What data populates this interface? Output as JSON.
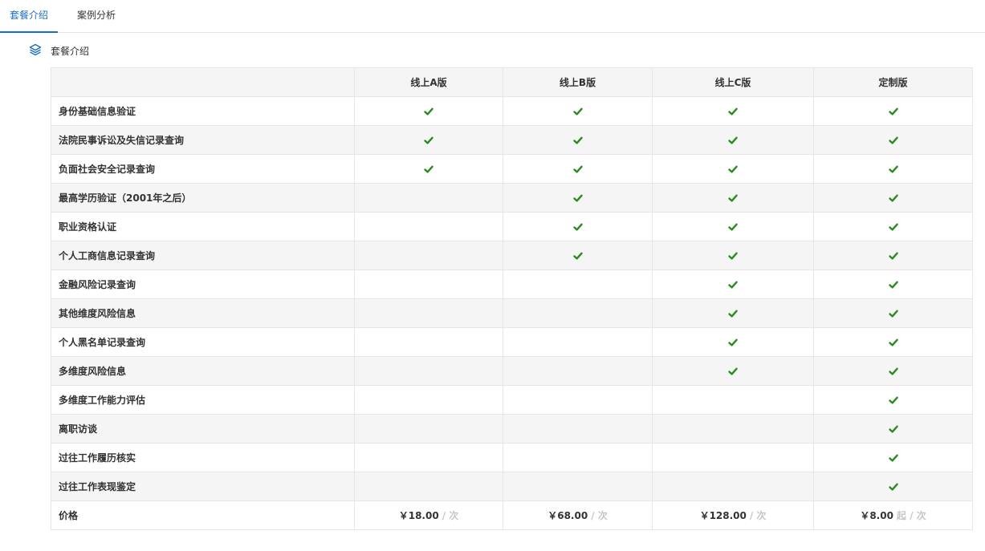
{
  "tabs": [
    {
      "label": "套餐介绍",
      "active": true
    },
    {
      "label": "案例分析",
      "active": false
    }
  ],
  "section": {
    "title": "套餐介绍",
    "icon": "layers-icon"
  },
  "colors": {
    "accent": "#1f6ec2",
    "check": "#2b8a1f",
    "muted": "#c6c6c6"
  },
  "table": {
    "columns": [
      "",
      "线上A版",
      "线上B版",
      "线上C版",
      "定制版"
    ],
    "rows": [
      {
        "name": "身份基础信息验证",
        "checks": [
          true,
          true,
          true,
          true
        ]
      },
      {
        "name": "法院民事诉讼及失信记录查询",
        "checks": [
          true,
          true,
          true,
          true
        ]
      },
      {
        "name": "负面社会安全记录查询",
        "checks": [
          true,
          true,
          true,
          true
        ]
      },
      {
        "name": "最高学历验证（2001年之后）",
        "checks": [
          false,
          true,
          true,
          true
        ]
      },
      {
        "name": "职业资格认证",
        "checks": [
          false,
          true,
          true,
          true
        ]
      },
      {
        "name": "个人工商信息记录查询",
        "checks": [
          false,
          true,
          true,
          true
        ]
      },
      {
        "name": "金融风险记录查询",
        "checks": [
          false,
          false,
          true,
          true
        ]
      },
      {
        "name": "其他维度风险信息",
        "checks": [
          false,
          false,
          true,
          true
        ]
      },
      {
        "name": "个人黑名单记录查询",
        "checks": [
          false,
          false,
          true,
          true
        ]
      },
      {
        "name": "多维度风险信息",
        "checks": [
          false,
          false,
          true,
          true
        ]
      },
      {
        "name": "多维度工作能力评估",
        "checks": [
          false,
          false,
          false,
          true
        ]
      },
      {
        "name": "离职访谈",
        "checks": [
          false,
          false,
          false,
          true
        ]
      },
      {
        "name": "过往工作履历核实",
        "checks": [
          false,
          false,
          false,
          true
        ]
      },
      {
        "name": "过往工作表现鉴定",
        "checks": [
          false,
          false,
          false,
          true
        ]
      }
    ],
    "price_row": {
      "label": "价格",
      "prices": [
        {
          "amount": "￥18.00",
          "unit": "/ 次"
        },
        {
          "amount": "￥68.00",
          "unit": "/ 次"
        },
        {
          "amount": "￥128.00",
          "unit": "/ 次"
        },
        {
          "amount": "￥8.00",
          "unit": "起 / 次"
        }
      ]
    }
  }
}
